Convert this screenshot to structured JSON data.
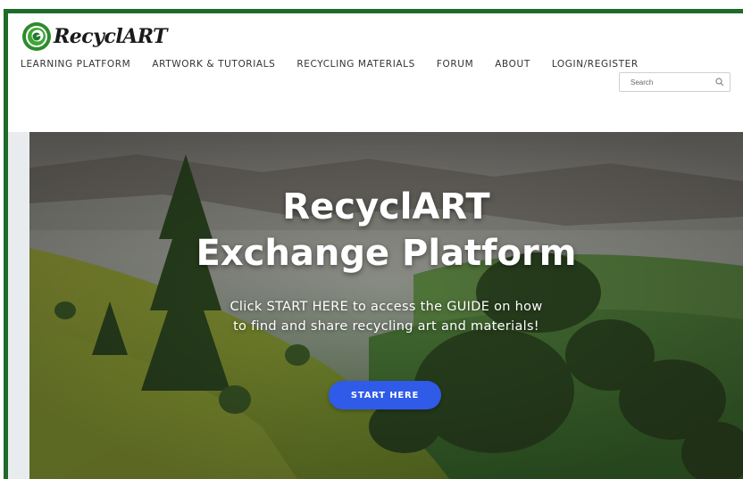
{
  "brand": {
    "logo_text": "RecyclART",
    "logo_icon": "green-swirl-icon",
    "frame_color": "#1e6b2a"
  },
  "nav": {
    "items": [
      {
        "label": "LEARNING PLATFORM"
      },
      {
        "label": "ARTWORK & TUTORIALS"
      },
      {
        "label": "RECYCLING MATERIALS"
      },
      {
        "label": "FORUM"
      },
      {
        "label": "ABOUT"
      },
      {
        "label": "LOGIN/REGISTER"
      }
    ]
  },
  "search": {
    "placeholder": "Search",
    "icon": "search-icon"
  },
  "hero": {
    "title_line1": "RecyclART",
    "title_line2": "Exchange Platform",
    "subtitle_line1": "Click START HERE to access the GUIDE on how",
    "subtitle_line2": "to find and share recycling art and materials!",
    "cta_label": "START HERE",
    "cta_color": "#2f5be8"
  }
}
